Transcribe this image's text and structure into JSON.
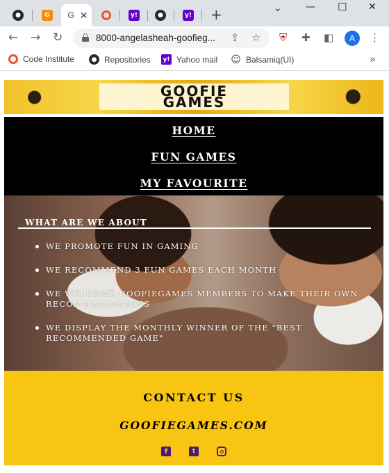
{
  "browser": {
    "tabs": [
      {
        "icon": "github-icon",
        "title": ""
      },
      {
        "icon": "gitpod-icon",
        "title": ""
      },
      {
        "icon": "gitpod-icon",
        "title": "G",
        "active": true
      },
      {
        "icon": "circle-icon",
        "title": ""
      },
      {
        "icon": "yahoo-icon",
        "title": ""
      },
      {
        "icon": "github-icon",
        "title": ""
      },
      {
        "icon": "yahoo-icon",
        "title": ""
      }
    ],
    "active_tab_title": "G",
    "address": "8000-angelasheah-goofieg...",
    "profile_initial": "A",
    "bookmarks": [
      "Code Institute",
      "Repositories",
      "Yahoo mail",
      "Balsamiq(UI)"
    ],
    "colors": {
      "tabstrip": "#dee1e6",
      "accent": "#1a73e8",
      "yahoo": "#6001d2"
    }
  },
  "site": {
    "logo_line1": "GOOFIE",
    "logo_line2": "GAMES",
    "nav": [
      "HOME",
      "FUN GAMES",
      "MY FAVOURITE"
    ],
    "about": {
      "title": "WHAT ARE WE ABOUT",
      "items": [
        "WE PROMOTE FUN IN GAMING",
        "WE RECOMMEND 3 FUN GAMES EACH MONTH",
        "WE WELCOME GOOFIEGAMES MEMBERS TO MAKE THEIR OWN RECOMMENDATIONS",
        "WE DISPLAY THE MONTHLY WINNER OF THE \"BEST RECOMMENDED GAME\""
      ]
    },
    "contact": {
      "title": "CONTACT US",
      "site": "GOOFIEGAMES.COM",
      "social": [
        "facebook-icon",
        "twitter-icon",
        "instagram-icon"
      ]
    },
    "colors": {
      "nav_bg": "#000000",
      "contact_bg": "#f9c513",
      "social": "#4a1a7a"
    }
  }
}
